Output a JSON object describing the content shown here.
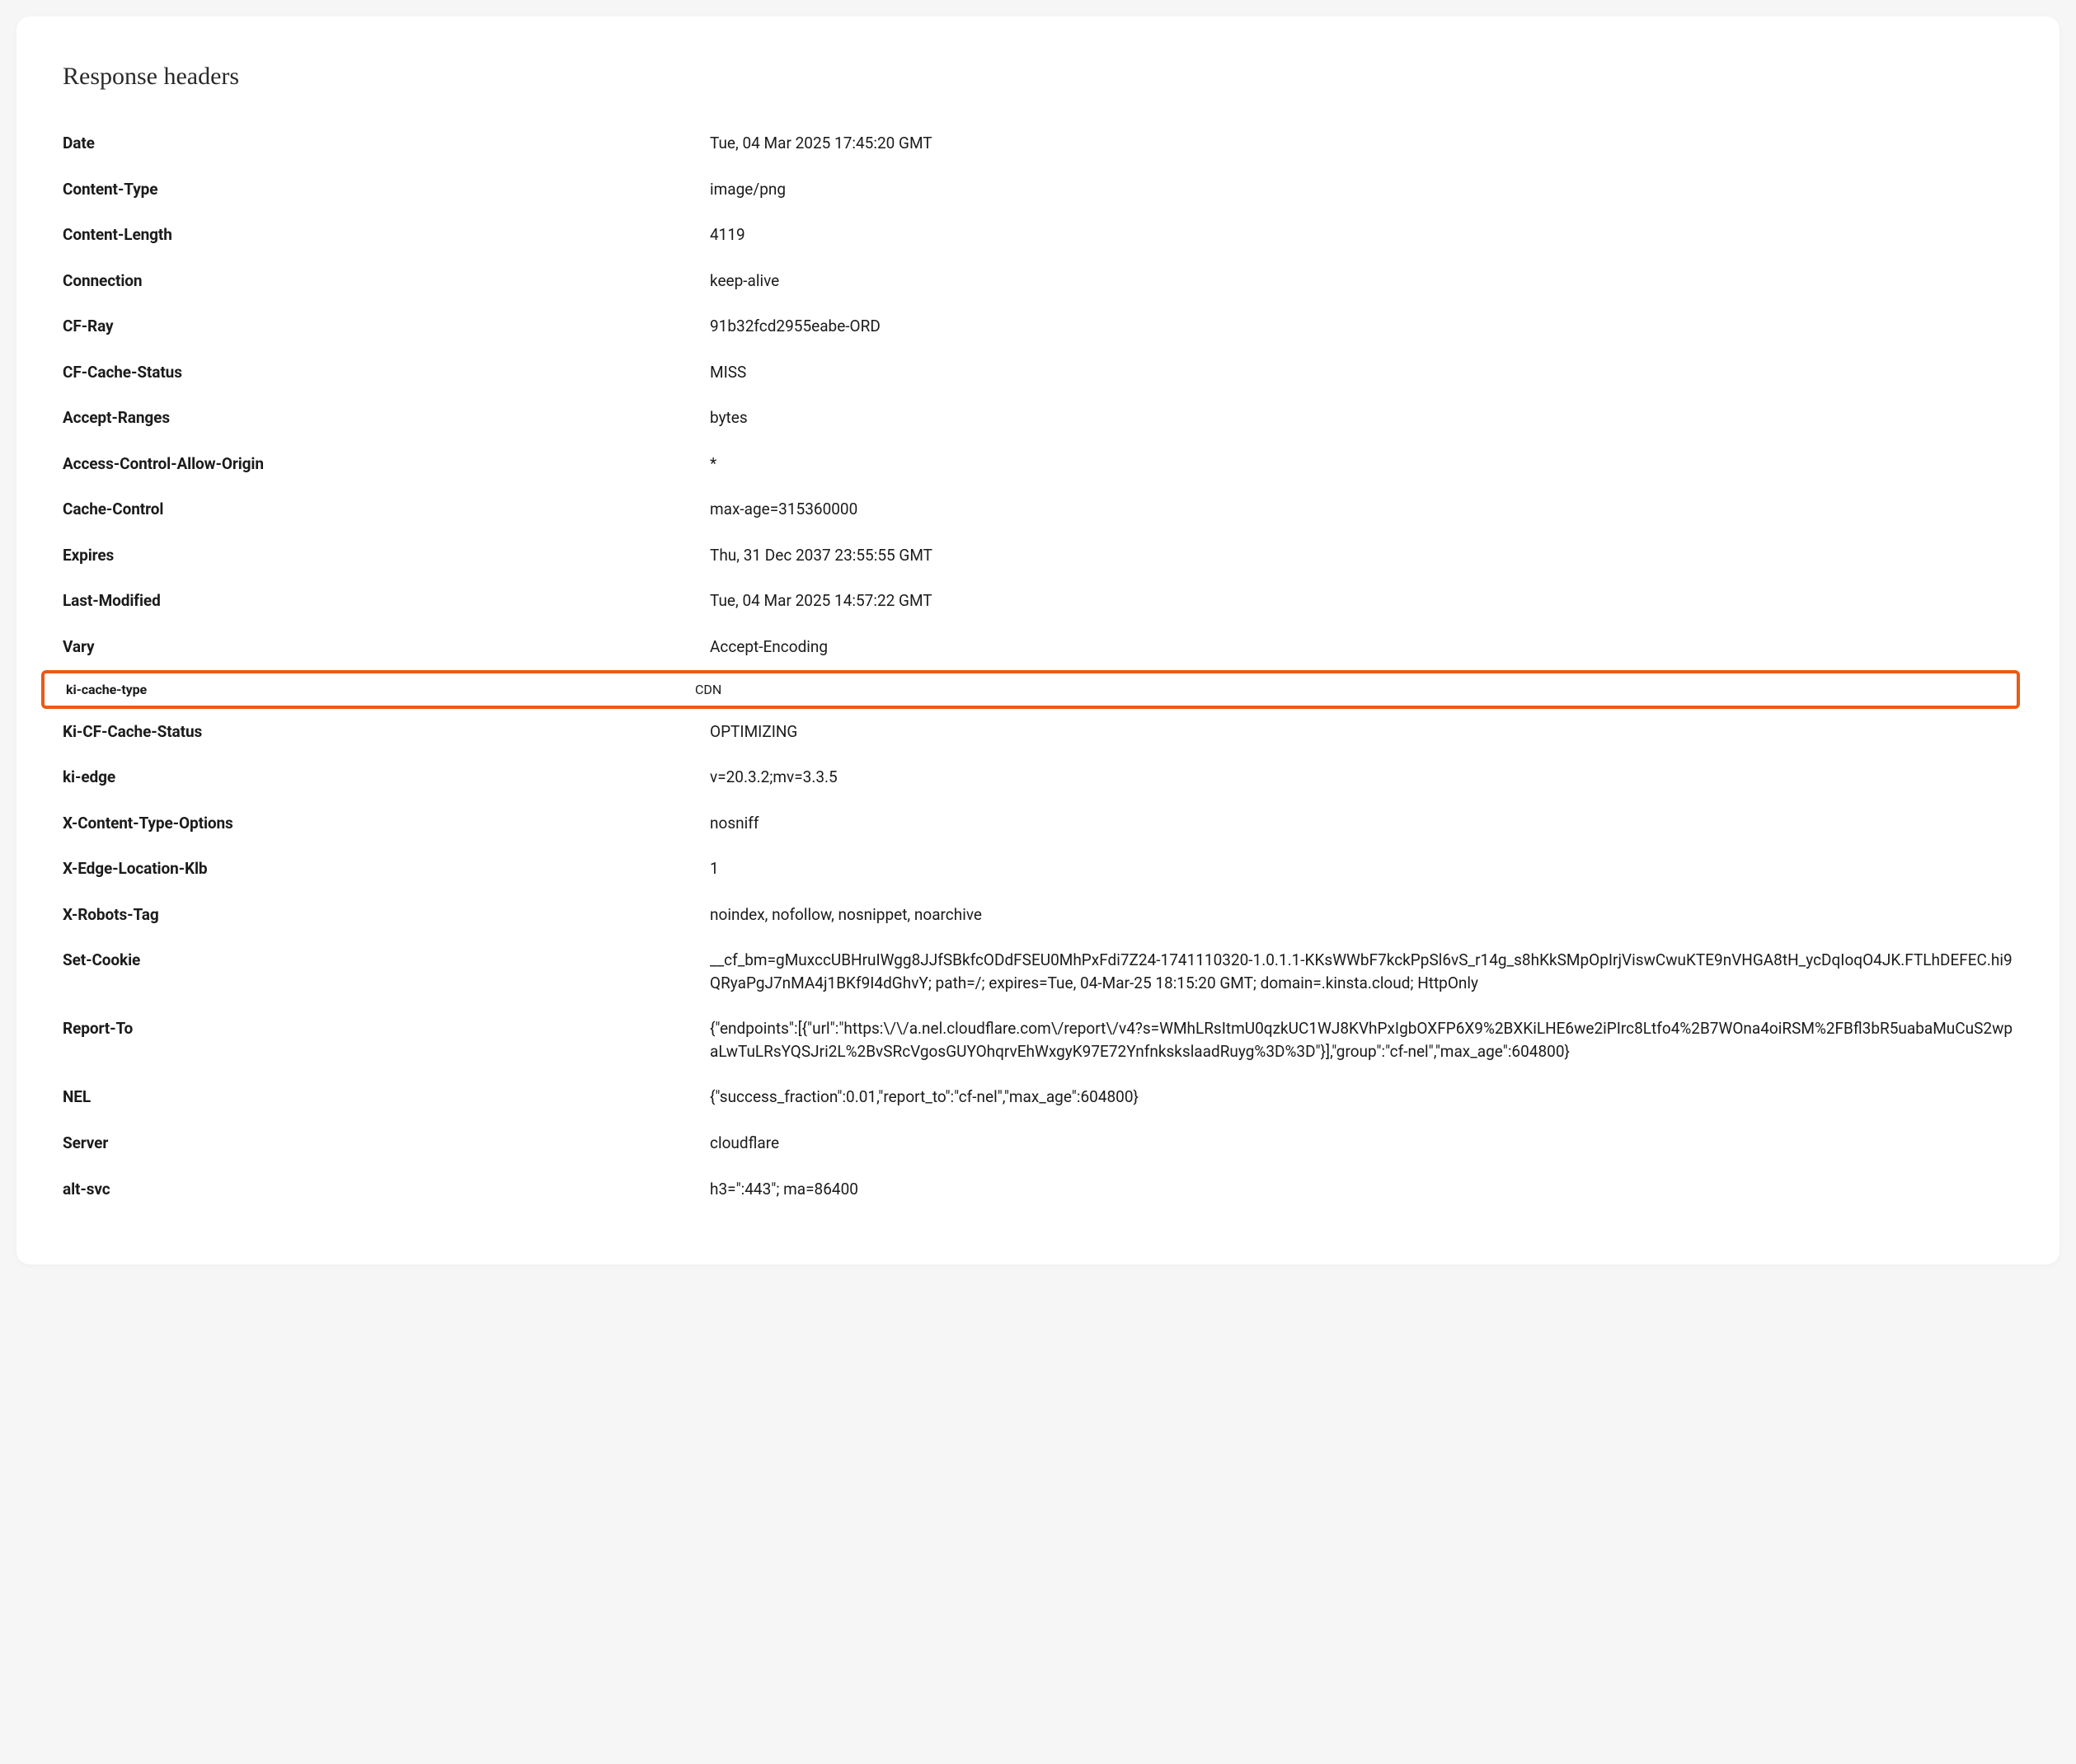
{
  "title": "Response headers",
  "highlighted_index": 12,
  "headers": [
    {
      "name": "Date",
      "value": "Tue, 04 Mar 2025 17:45:20 GMT"
    },
    {
      "name": "Content-Type",
      "value": "image/png"
    },
    {
      "name": "Content-Length",
      "value": "4119"
    },
    {
      "name": "Connection",
      "value": "keep-alive"
    },
    {
      "name": "CF-Ray",
      "value": "91b32fcd2955eabe-ORD"
    },
    {
      "name": "CF-Cache-Status",
      "value": "MISS"
    },
    {
      "name": "Accept-Ranges",
      "value": "bytes"
    },
    {
      "name": "Access-Control-Allow-Origin",
      "value": "*"
    },
    {
      "name": "Cache-Control",
      "value": "max-age=315360000"
    },
    {
      "name": "Expires",
      "value": "Thu, 31 Dec 2037 23:55:55 GMT"
    },
    {
      "name": "Last-Modified",
      "value": "Tue, 04 Mar 2025 14:57:22 GMT"
    },
    {
      "name": "Vary",
      "value": "Accept-Encoding"
    },
    {
      "name": "ki-cache-type",
      "value": "CDN"
    },
    {
      "name": "Ki-CF-Cache-Status",
      "value": "OPTIMIZING"
    },
    {
      "name": "ki-edge",
      "value": "v=20.3.2;mv=3.3.5"
    },
    {
      "name": "X-Content-Type-Options",
      "value": "nosniff"
    },
    {
      "name": "X-Edge-Location-Klb",
      "value": "1"
    },
    {
      "name": "X-Robots-Tag",
      "value": "noindex, nofollow, nosnippet, noarchive"
    },
    {
      "name": "Set-Cookie",
      "value": "__cf_bm=gMuxccUBHruIWgg8JJfSBkfcODdFSEU0MhPxFdi7Z24-1741110320-1.0.1.1-KKsWWbF7kckPpSl6vS_r14g_s8hKkSMpOpIrjViswCwuKTE9nVHGA8tH_ycDqIoqO4JK.FTLhDEFEC.hi9QRyaPgJ7nMA4j1BKf9I4dGhvY; path=/; expires=Tue, 04-Mar-25 18:15:20 GMT; domain=.kinsta.cloud; HttpOnly"
    },
    {
      "name": "Report-To",
      "value": "{\"endpoints\":[{\"url\":\"https:\\/\\/a.nel.cloudflare.com\\/report\\/v4?s=WMhLRsItmU0qzkUC1WJ8KVhPxIgbOXFP6X9%2BXKiLHE6we2iPIrc8Ltfo4%2B7WOna4oiRSM%2FBfl3bR5uabaMuCuS2wpaLwTuLRsYQSJri2L%2BvSRcVgosGUYOhqrvEhWxgyK97E72YnfnkskslaadRuyg%3D%3D\"}],\"group\":\"cf-nel\",\"max_age\":604800}"
    },
    {
      "name": "NEL",
      "value": "{\"success_fraction\":0.01,\"report_to\":\"cf-nel\",\"max_age\":604800}"
    },
    {
      "name": "Server",
      "value": "cloudflare"
    },
    {
      "name": "alt-svc",
      "value": "h3=\":443\"; ma=86400"
    }
  ]
}
